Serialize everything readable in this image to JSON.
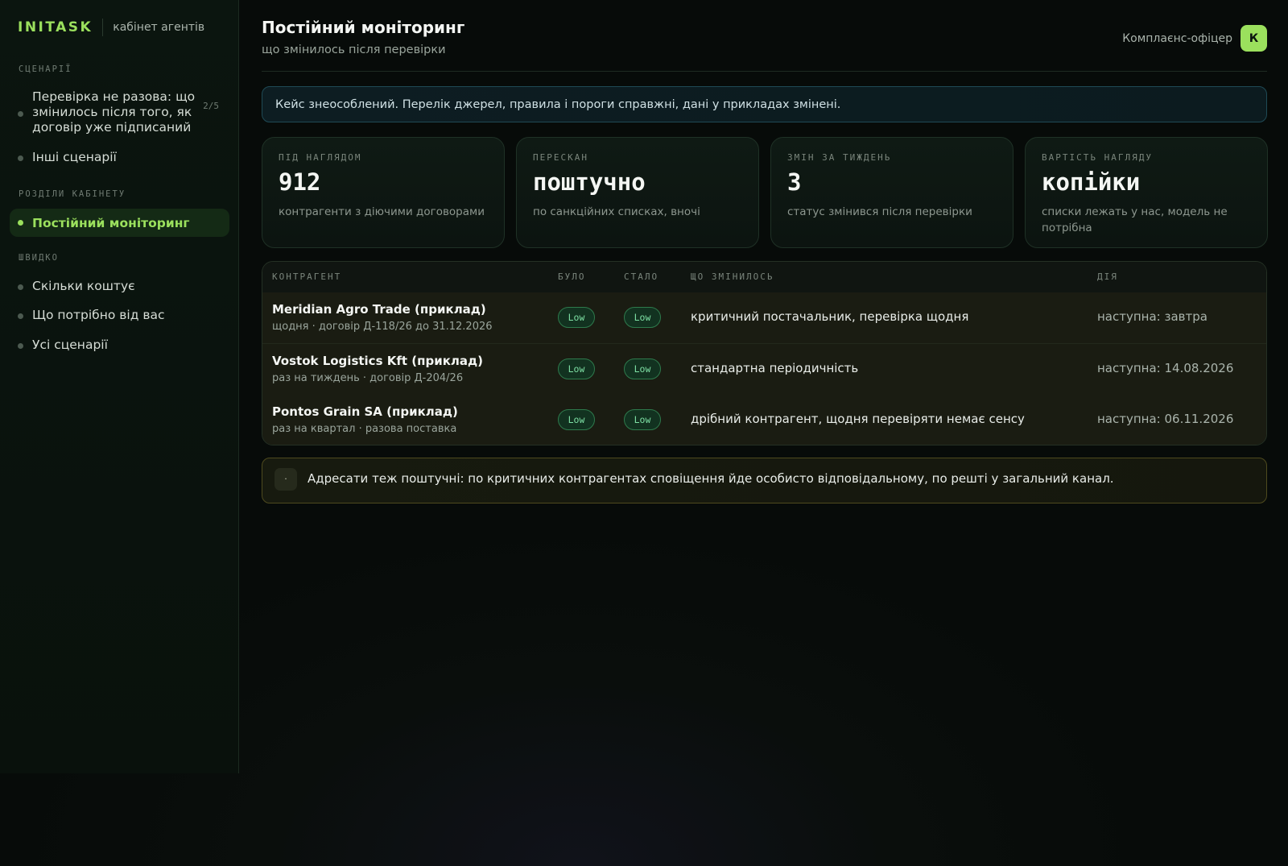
{
  "brand": {
    "logo": "INITASK",
    "subtitle": "кабінет агентів"
  },
  "sidebar": {
    "sections": [
      {
        "title": "СЦЕНАРІЇ"
      },
      {
        "title": "РОЗДІЛИ КАБІНЕТУ"
      },
      {
        "title": "ШВИДКО"
      }
    ],
    "scenario_main": {
      "lines": [
        "Перевірка не разова: що",
        "змінилось після того, як",
        "договір уже підписаний"
      ],
      "count": "2/5"
    },
    "scenario_other": "Інші сценарії",
    "active_section": "Постійний моніторинг",
    "quick": [
      "Скільки коштує",
      "Що потрібно від вас",
      "Усі сценарії"
    ]
  },
  "header": {
    "title": "Постійний моніторинг",
    "subtitle": "що змінилось після перевірки",
    "user_role": "Комплаєнс-офіцер",
    "avatar": "К"
  },
  "notice": "Кейс знеособлений. Перелік джерел, правила і пороги справжні, дані у прикладах змінені.",
  "stats": [
    {
      "label": "ПІД НАГЛЯДОМ",
      "value": "912",
      "desc": "контрагенти з діючими договорами"
    },
    {
      "label": "ПЕРЕСКАН",
      "value": "поштучно",
      "desc": "по санкційних списках, вночі"
    },
    {
      "label": "ЗМІН ЗА ТИЖДЕНЬ",
      "value": "3",
      "desc": "статус змінився після перевірки"
    },
    {
      "label": "ВАРТІСТЬ НАГЛЯДУ",
      "value": "копійки",
      "desc": "списки лежать у нас, модель не потрібна"
    }
  ],
  "table": {
    "headers": {
      "counterparty": "КОНТРАГЕНТ",
      "was": "БУЛО",
      "now": "СТАЛО",
      "changed": "ЩО ЗМІНИЛОСЬ",
      "action": "ДІЯ"
    },
    "rows": [
      {
        "name": "Meridian Agro Trade (приклад)",
        "meta": "щодня · договір Д-118/26 до 31.12.2026",
        "was": "Low",
        "now": "Low",
        "changed": "критичний постачальник, перевірка щодня",
        "action": "наступна: завтра"
      },
      {
        "name": "Vostok Logistics Kft (приклад)",
        "meta": "раз на тиждень · договір Д-204/26",
        "was": "Low",
        "now": "Low",
        "changed": "стандартна періодичність",
        "action": "наступна: 14.08.2026"
      },
      {
        "name": "Pontos Grain SA (приклад)",
        "meta": "раз на квартал · разова поставка",
        "was": "Low",
        "now": "Low",
        "changed": "дрібний контрагент, щодня перевіряти немає сенсу",
        "action": "наступна: 06.11.2026"
      }
    ]
  },
  "footnote": {
    "icon": "·",
    "text": "Адресати теж поштучні: по критичних контрагентах сповіщення йде особисто відповідальному, по решті у загальний канал."
  }
}
